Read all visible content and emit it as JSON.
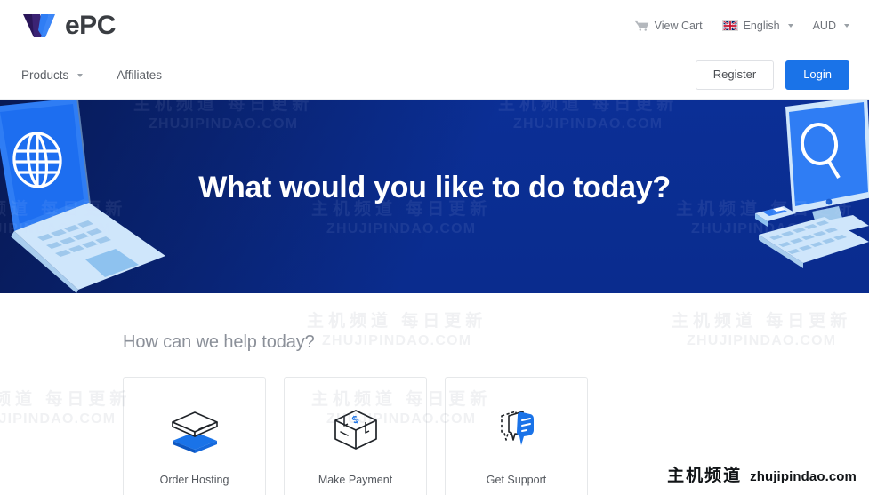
{
  "brand": {
    "logo_icon": "wepc-w-logo-icon",
    "logo_text": "ePC",
    "accent_blue": "#1a73e8",
    "logo_dark": "#2b1a5e",
    "logo_light": "#2f7df4"
  },
  "topbar": {
    "cart": {
      "icon": "shopping-cart-icon",
      "label": "View Cart"
    },
    "language": {
      "icon": "uk-flag-icon",
      "label": "English",
      "caret": "chevron-down-icon"
    },
    "currency": {
      "label": "AUD",
      "caret": "chevron-down-icon"
    }
  },
  "nav": {
    "links": [
      {
        "label": "Products",
        "has_caret": true
      },
      {
        "label": "Affiliates",
        "has_caret": false
      }
    ],
    "register_label": "Register",
    "login_label": "Login"
  },
  "hero": {
    "title": "What would you like to do today?",
    "bg_color": "#0b2f96",
    "left_art": "isometric-laptop-globe-illustration",
    "right_art": "isometric-desktop-search-illustration"
  },
  "main": {
    "section_title": "How can we help today?",
    "cards": [
      {
        "label": "Order Hosting",
        "icon": "stacked-layers-icon"
      },
      {
        "label": "Make Payment",
        "icon": "cash-box-dollar-icon"
      },
      {
        "label": "Get Support",
        "icon": "chat-bubbles-icon"
      }
    ]
  },
  "watermark": {
    "cn": "主机频道 每日更新",
    "en": "ZHUJIPINDAO.COM",
    "corner_cn": "主机频道",
    "corner_en": "zhujipindao.com"
  }
}
